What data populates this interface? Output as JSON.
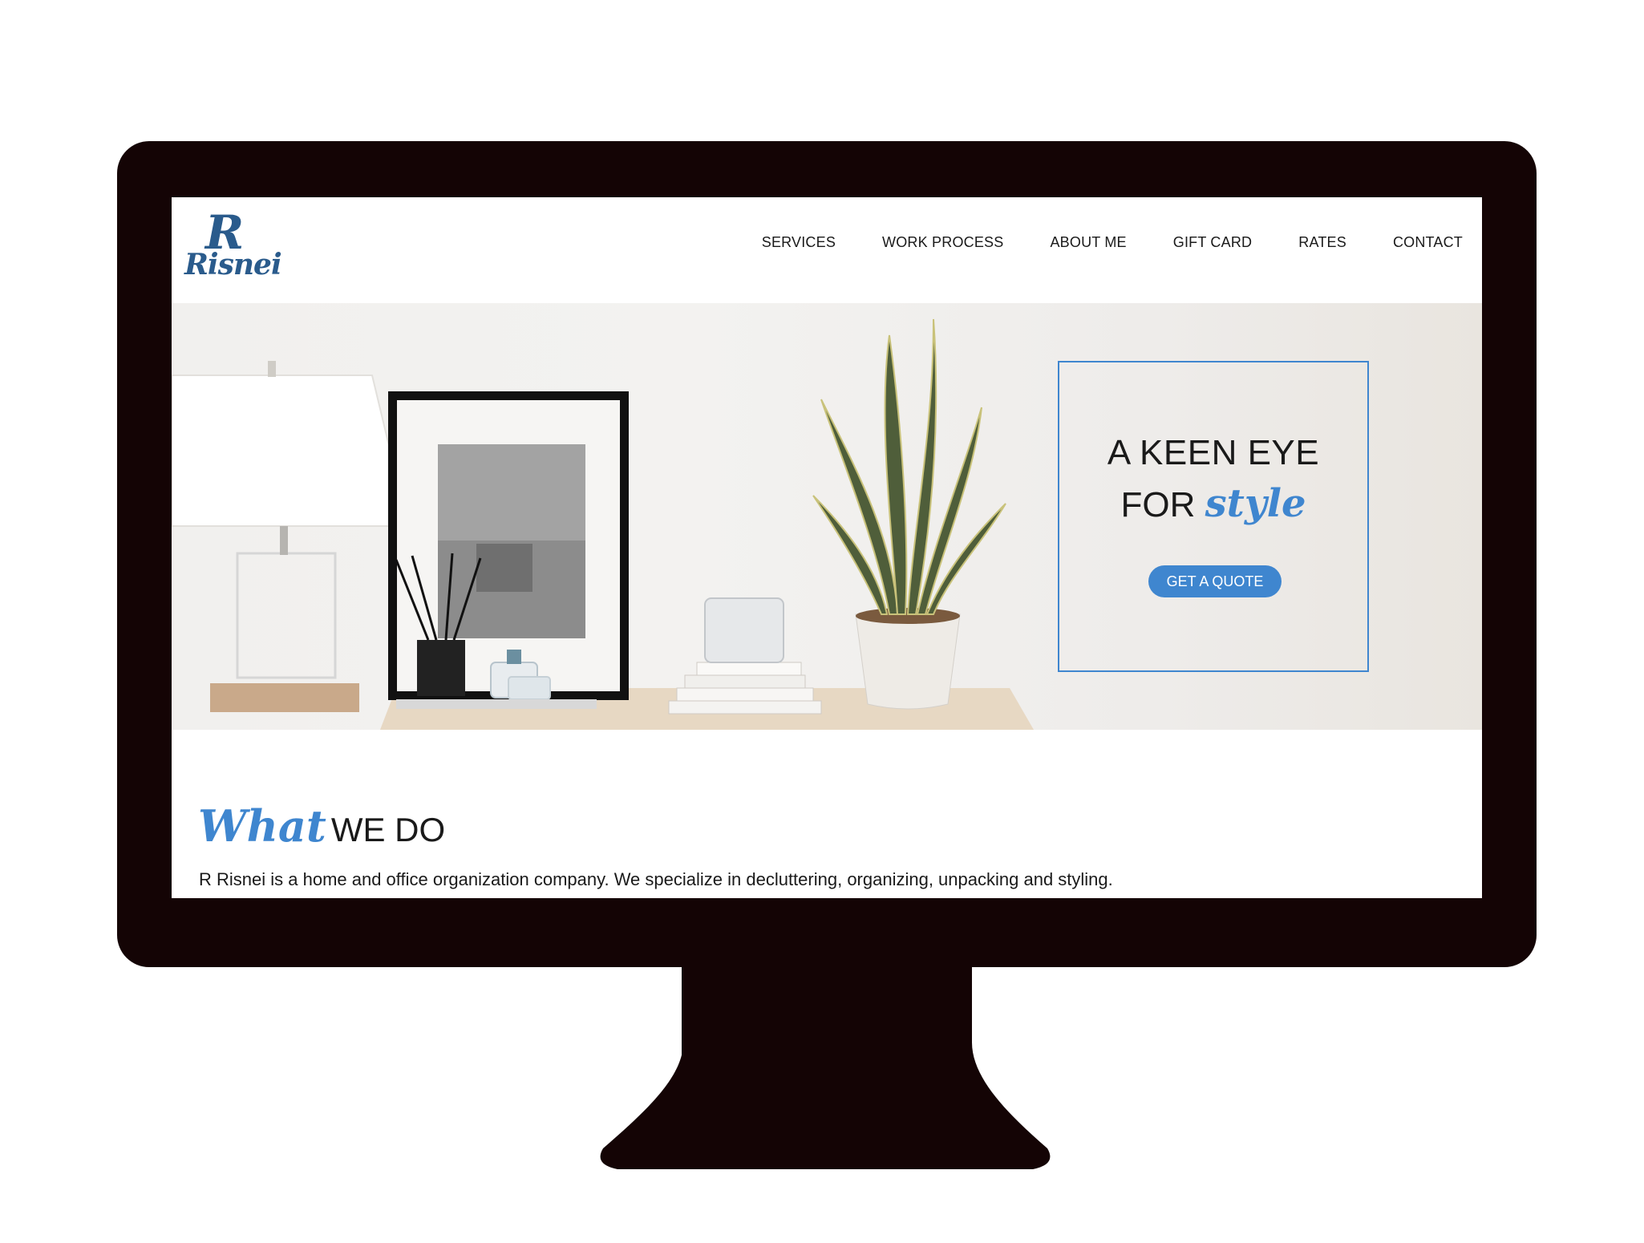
{
  "brand": {
    "logo_letter": "R",
    "logo_name": "Risnei"
  },
  "nav": {
    "items": [
      "SERVICES",
      "WORK PROCESS",
      "ABOUT ME",
      "GIFT CARD",
      "RATES",
      "CONTACT"
    ]
  },
  "hero": {
    "line1": "A KEEN EYE",
    "line2_prefix": "FOR",
    "line2_script": "style",
    "cta_label": "GET A QUOTE"
  },
  "what_we_do": {
    "title_script": "What",
    "title_plain": "WE DO",
    "description": "R Risnei is a home and office organization company. We specialize in decluttering, organizing, unpacking and styling."
  },
  "colors": {
    "accent": "#3f86cf",
    "logo": "#2a5b8c",
    "monitor": "#140405"
  }
}
